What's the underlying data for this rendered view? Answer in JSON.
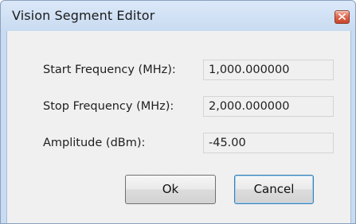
{
  "window": {
    "title": "Vision Segment Editor"
  },
  "form": {
    "start_frequency": {
      "label": "Start Frequency (MHz):",
      "value": "1,000.000000"
    },
    "stop_frequency": {
      "label": "Stop Frequency (MHz):",
      "value": "2,000.000000"
    },
    "amplitude": {
      "label": "Amplitude (dBm):",
      "value": "-45.00"
    }
  },
  "buttons": {
    "ok_label": "Ok",
    "cancel_label": "Cancel"
  },
  "icons": {
    "close": "close-icon"
  },
  "colors": {
    "title_bar": "#c9dbf1",
    "close_button": "#d9553a",
    "client_background": "#f0f0f0",
    "default_button_border": "#3c7fb1"
  }
}
